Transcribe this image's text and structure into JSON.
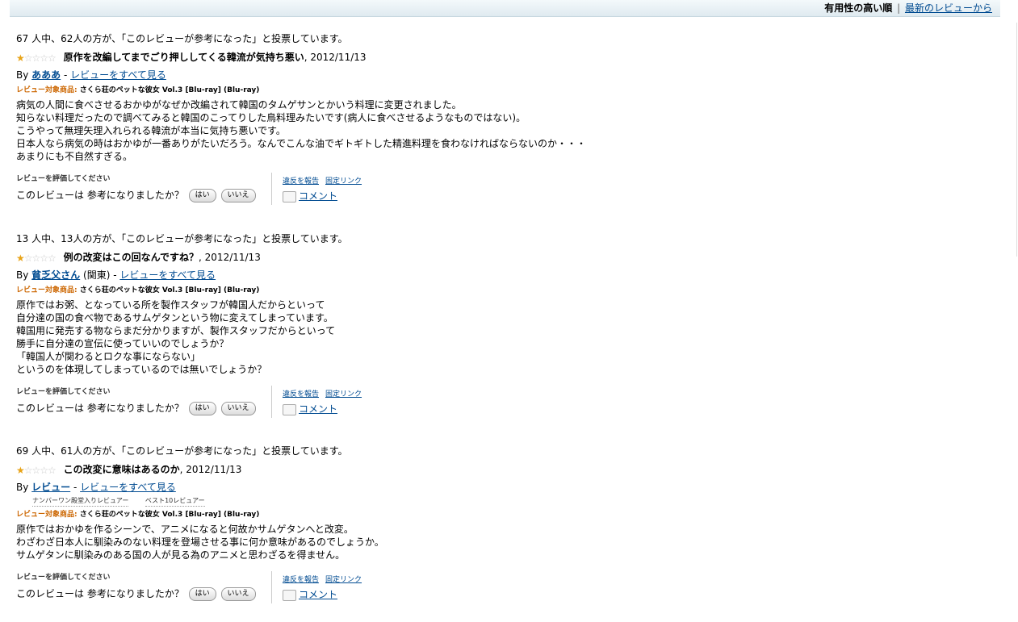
{
  "sort": {
    "current": "有用性の高い順",
    "separator": "|",
    "newest": "最新のレビューから"
  },
  "common": {
    "by": "By",
    "see_all": "レビューをすべて見る",
    "product_label": "レビュー対象商品:",
    "product_name": "さくら荘のペットな彼女 Vol.3 [Blu-ray] (Blu-ray)",
    "rate_label": "レビューを評価してください",
    "helpful_question": "このレビューは 参考になりましたか？",
    "yes": "はい",
    "no": "いいえ",
    "report": "違反を報告",
    "permalink": "固定リンク",
    "comment": "コメント",
    "star_filled": "★",
    "star_empty": "☆☆☆☆"
  },
  "reviews": [
    {
      "votes": "67 人中、62人の方が、「このレビューが参考になった」と投票しています。",
      "rating": 1,
      "title": "原作を改編してまでごり押ししてくる韓流が気持ち悪い",
      "date": ", 2012/11/13",
      "author": "あああ",
      "location": "",
      "body": [
        "病気の人間に食べさせるおかゆがなぜか改編されて韓国のタムゲサンとかいう料理に変更されました。",
        "知らない料理だったので調べてみると韓国のこってりした鳥料理みたいです(病人に食べさせるようなものではない)。",
        "こうやって無理矢理入れられる韓流が本当に気持ち悪いです。",
        "日本人なら病気の時はおかゆが一番ありがたいだろう。なんでこんな油でギトギトした精進料理を食わなければならないのか・・・",
        "あまりにも不自然すぎる。"
      ]
    },
    {
      "votes": "13 人中、13人の方が、「このレビューが参考になった」と投票しています。",
      "rating": 1,
      "title": "例の改変はこの回なんですね？",
      "date": ", 2012/11/13",
      "author": "貧乏父さん",
      "location": "(関東)",
      "body": [
        "原作ではお粥、となっている所を製作スタッフが韓国人だからといって",
        "自分達の国の食べ物であるサムゲタンという物に変えてしまっています。",
        "韓国用に発売する物ならまだ分かりますが、製作スタッフだからといって",
        "勝手に自分達の宣伝に使っていいのでしょうか？",
        "「韓国人が関わるとロクな事にならない」",
        "というのを体現してしまっているのでは無いでしょうか？"
      ]
    },
    {
      "votes": "69 人中、61人の方が、「このレビューが参考になった」と投票しています。",
      "rating": 1,
      "title": "この改変に意味はあるのか",
      "date": ", 2012/11/13",
      "author": "レビュー",
      "location": "",
      "badges": [
        "ナンバーワン殿堂入りレビュアー",
        "ベスト10レビュアー"
      ],
      "body": [
        "原作ではおかゆを作るシーンで、アニメになると何故かサムゲタンへと改変。",
        "わざわざ日本人に馴染みのない料理を登場させる事に何か意味があるのでしょうか。",
        "サムゲタンに馴染みのある国の人が見る為のアニメと思わざるを得ません。"
      ]
    }
  ]
}
